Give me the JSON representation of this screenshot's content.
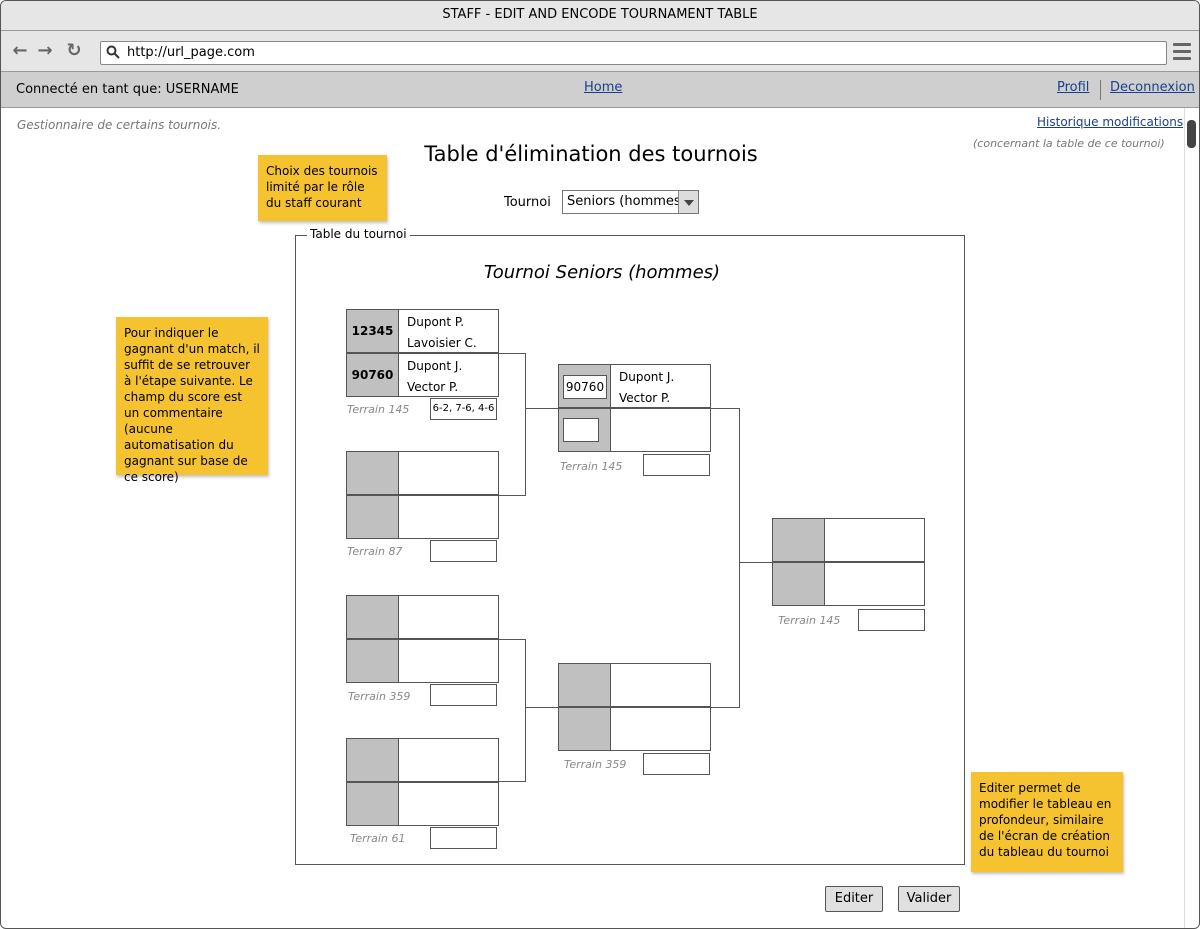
{
  "window": {
    "title": "STAFF - EDIT AND ENCODE TOURNAMENT TABLE"
  },
  "browser": {
    "url": "http://url_page.com"
  },
  "userbar": {
    "connected_as": "Connecté en tant que: USERNAME",
    "home": "Home",
    "profil": "Profil",
    "logout": "Deconnexion"
  },
  "header": {
    "subtitle": "Gestionnaire de certains tournois.",
    "history_link": "Historique modifications",
    "history_note": "(concernant la table de ce tournoi)",
    "title": "Table d'élimination des tournois"
  },
  "tournament_select": {
    "label": "Tournoi",
    "value": "Seniors (hommes)"
  },
  "notes": {
    "choice": "Choix des tournois limité par le rôle du staff courant",
    "winner": "Pour indiquer le gagnant d'un match, il suffit de se retrouver à l'étape suivante. Le champ du score est un commentaire (aucune automatisation du gagnant sur base de ce score)",
    "edit": "Editer permet de modifier le tableau en profondeur, similaire de l'écran de création du tableau du tournoi"
  },
  "bracket": {
    "legend": "Table du tournoi",
    "title": "Tournoi Seniors (hommes)",
    "round1": [
      {
        "seed1": "12345",
        "names1": [
          "Dupont P.",
          "Lavoisier C."
        ],
        "seed2": "90760",
        "names2": [
          "Dupont J.",
          "Vector P."
        ],
        "terrain": "Terrain 145",
        "score": "6-2, 7-6, 4-6"
      },
      {
        "terrain": "Terrain 87",
        "score": ""
      },
      {
        "terrain": "Terrain 359",
        "score": ""
      },
      {
        "terrain": "Terrain 61",
        "score": ""
      }
    ],
    "round2": [
      {
        "seed1": "90760",
        "names1": [
          "Dupont J.",
          "Vector P."
        ],
        "terrain": "Terrain 145",
        "score": ""
      },
      {
        "terrain": "Terrain 359",
        "score": ""
      }
    ],
    "final": {
      "terrain": "Terrain 145",
      "score": ""
    }
  },
  "buttons": {
    "edit": "Editer",
    "validate": "Valider"
  },
  "colors": {
    "sticky": "#f5c230",
    "link": "#1a3f8f",
    "seed_cell": "#c0c0c0"
  }
}
